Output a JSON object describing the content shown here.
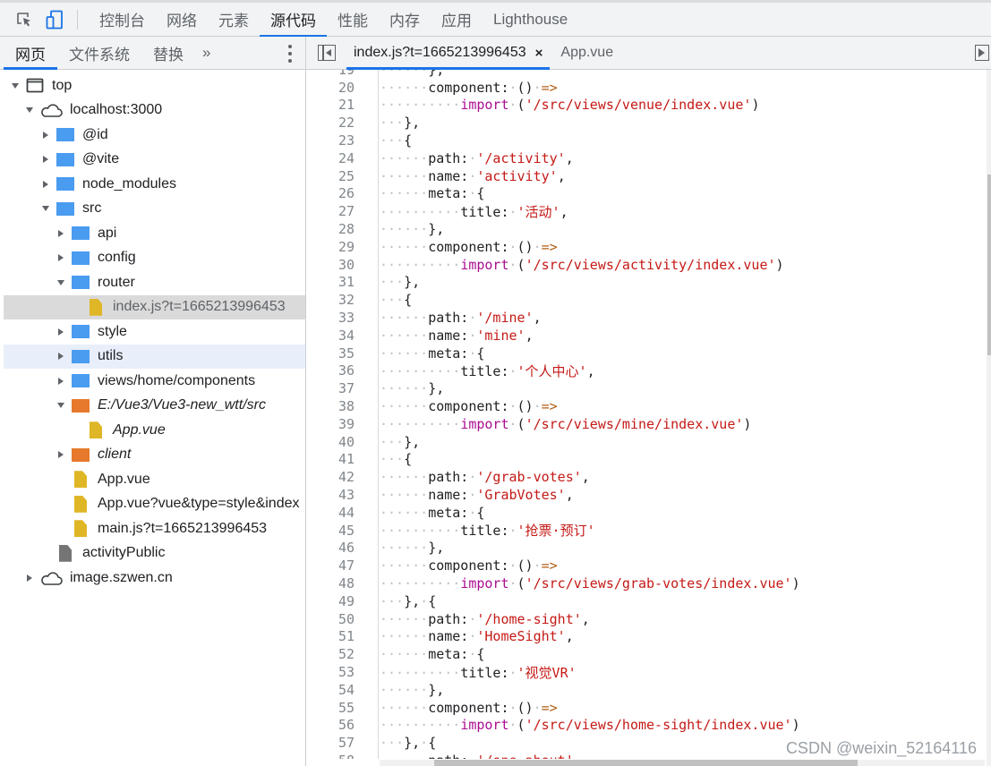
{
  "toolbar": {
    "inspect_icon": "element-picker-icon",
    "device_icon": "device-toolbar-icon",
    "tabs": [
      {
        "label": "控制台",
        "active": false
      },
      {
        "label": "网络",
        "active": false
      },
      {
        "label": "元素",
        "active": false
      },
      {
        "label": "源代码",
        "active": true
      },
      {
        "label": "性能",
        "active": false
      },
      {
        "label": "内存",
        "active": false
      },
      {
        "label": "应用",
        "active": false
      },
      {
        "label": "Lighthouse",
        "active": false
      }
    ]
  },
  "navigator": {
    "tabs": [
      {
        "label": "网页",
        "active": true
      },
      {
        "label": "文件系统",
        "active": false
      },
      {
        "label": "替换",
        "active": false
      }
    ],
    "more_label": "»",
    "tree": [
      {
        "label": "top",
        "depth": 0,
        "arrow": "down",
        "icon": "frame",
        "state": ""
      },
      {
        "label": "localhost:3000",
        "depth": 1,
        "arrow": "down",
        "icon": "cloud",
        "state": ""
      },
      {
        "label": "@id",
        "depth": 2,
        "arrow": "right",
        "icon": "folder-blue",
        "state": ""
      },
      {
        "label": "@vite",
        "depth": 2,
        "arrow": "right",
        "icon": "folder-blue",
        "state": ""
      },
      {
        "label": "node_modules",
        "depth": 2,
        "arrow": "right",
        "icon": "folder-blue",
        "state": ""
      },
      {
        "label": "src",
        "depth": 2,
        "arrow": "down",
        "icon": "folder-blue",
        "state": ""
      },
      {
        "label": "api",
        "depth": 3,
        "arrow": "right",
        "icon": "folder-blue",
        "state": ""
      },
      {
        "label": "config",
        "depth": 3,
        "arrow": "right",
        "icon": "folder-blue",
        "state": ""
      },
      {
        "label": "router",
        "depth": 3,
        "arrow": "down",
        "icon": "folder-blue",
        "state": ""
      },
      {
        "label": "index.js?t=1665213996453",
        "depth": 4,
        "arrow": "none",
        "icon": "file-yellow",
        "state": "selected"
      },
      {
        "label": "style",
        "depth": 3,
        "arrow": "right",
        "icon": "folder-blue",
        "state": ""
      },
      {
        "label": "utils",
        "depth": 3,
        "arrow": "right",
        "icon": "folder-blue",
        "state": "hover"
      },
      {
        "label": "views/home/components",
        "depth": 3,
        "arrow": "right",
        "icon": "folder-blue",
        "state": ""
      },
      {
        "label": "E:/Vue3/Vue3-new_wtt/src",
        "depth": 3,
        "arrow": "down",
        "icon": "folder-orange",
        "state": "italic"
      },
      {
        "label": "App.vue",
        "depth": 4,
        "arrow": "none",
        "icon": "file-yellow",
        "state": "italic"
      },
      {
        "label": "client",
        "depth": 3,
        "arrow": "right",
        "icon": "folder-orange",
        "state": "italic"
      },
      {
        "label": "App.vue",
        "depth": 3,
        "arrow": "none",
        "icon": "file-yellow",
        "state": ""
      },
      {
        "label": "App.vue?vue&type=style&index",
        "depth": 3,
        "arrow": "none",
        "icon": "file-yellow",
        "state": ""
      },
      {
        "label": "main.js?t=1665213996453",
        "depth": 3,
        "arrow": "none",
        "icon": "file-yellow",
        "state": ""
      },
      {
        "label": "activityPublic",
        "depth": 2,
        "arrow": "none",
        "icon": "file-gray",
        "state": ""
      },
      {
        "label": "image.szwen.cn",
        "depth": 1,
        "arrow": "right",
        "icon": "cloud",
        "state": ""
      }
    ]
  },
  "editor": {
    "open_tabs": [
      {
        "label": "index.js?t=1665213996453",
        "active": true,
        "close_label": "×"
      },
      {
        "label": "App.vue",
        "active": false
      }
    ],
    "lines": [
      {
        "n": 19,
        "indent": 6,
        "tokens": [
          [
            "p",
            "},"
          ]
        ]
      },
      {
        "n": 20,
        "indent": 6,
        "tokens": [
          [
            "p",
            "component:"
          ],
          [
            "d",
            "·"
          ],
          [
            "p",
            "()"
          ],
          [
            "d",
            "·"
          ],
          [
            "o",
            "=>"
          ]
        ]
      },
      {
        "n": 21,
        "indent": 10,
        "tokens": [
          [
            "k",
            "import"
          ],
          [
            "d",
            "·"
          ],
          [
            "p",
            "("
          ],
          [
            "s",
            "'/src/views/venue/index.vue'"
          ],
          [
            "p",
            ")"
          ]
        ]
      },
      {
        "n": 22,
        "indent": 3,
        "tokens": [
          [
            "p",
            "},"
          ]
        ]
      },
      {
        "n": 23,
        "indent": 3,
        "tokens": [
          [
            "p",
            "{"
          ]
        ]
      },
      {
        "n": 24,
        "indent": 6,
        "tokens": [
          [
            "p",
            "path:"
          ],
          [
            "d",
            "·"
          ],
          [
            "s",
            "'/activity'"
          ],
          [
            "p",
            ","
          ]
        ]
      },
      {
        "n": 25,
        "indent": 6,
        "tokens": [
          [
            "p",
            "name:"
          ],
          [
            "d",
            "·"
          ],
          [
            "s",
            "'activity'"
          ],
          [
            "p",
            ","
          ]
        ]
      },
      {
        "n": 26,
        "indent": 6,
        "tokens": [
          [
            "p",
            "meta:"
          ],
          [
            "d",
            "·"
          ],
          [
            "p",
            "{"
          ]
        ]
      },
      {
        "n": 27,
        "indent": 10,
        "tokens": [
          [
            "p",
            "title:"
          ],
          [
            "d",
            "·"
          ],
          [
            "s",
            "'活动'"
          ],
          [
            "p",
            ","
          ]
        ]
      },
      {
        "n": 28,
        "indent": 6,
        "tokens": [
          [
            "p",
            "},"
          ]
        ]
      },
      {
        "n": 29,
        "indent": 6,
        "tokens": [
          [
            "p",
            "component:"
          ],
          [
            "d",
            "·"
          ],
          [
            "p",
            "()"
          ],
          [
            "d",
            "·"
          ],
          [
            "o",
            "=>"
          ]
        ]
      },
      {
        "n": 30,
        "indent": 10,
        "tokens": [
          [
            "k",
            "import"
          ],
          [
            "d",
            "·"
          ],
          [
            "p",
            "("
          ],
          [
            "s",
            "'/src/views/activity/index.vue'"
          ],
          [
            "p",
            ")"
          ]
        ]
      },
      {
        "n": 31,
        "indent": 3,
        "tokens": [
          [
            "p",
            "},"
          ]
        ]
      },
      {
        "n": 32,
        "indent": 3,
        "tokens": [
          [
            "p",
            "{"
          ]
        ]
      },
      {
        "n": 33,
        "indent": 6,
        "tokens": [
          [
            "p",
            "path:"
          ],
          [
            "d",
            "·"
          ],
          [
            "s",
            "'/mine'"
          ],
          [
            "p",
            ","
          ]
        ]
      },
      {
        "n": 34,
        "indent": 6,
        "tokens": [
          [
            "p",
            "name:"
          ],
          [
            "d",
            "·"
          ],
          [
            "s",
            "'mine'"
          ],
          [
            "p",
            ","
          ]
        ]
      },
      {
        "n": 35,
        "indent": 6,
        "tokens": [
          [
            "p",
            "meta:"
          ],
          [
            "d",
            "·"
          ],
          [
            "p",
            "{"
          ]
        ]
      },
      {
        "n": 36,
        "indent": 10,
        "tokens": [
          [
            "p",
            "title:"
          ],
          [
            "d",
            "·"
          ],
          [
            "s",
            "'个人中心'"
          ],
          [
            "p",
            ","
          ]
        ]
      },
      {
        "n": 37,
        "indent": 6,
        "tokens": [
          [
            "p",
            "},"
          ]
        ]
      },
      {
        "n": 38,
        "indent": 6,
        "tokens": [
          [
            "p",
            "component:"
          ],
          [
            "d",
            "·"
          ],
          [
            "p",
            "()"
          ],
          [
            "d",
            "·"
          ],
          [
            "o",
            "=>"
          ]
        ]
      },
      {
        "n": 39,
        "indent": 10,
        "tokens": [
          [
            "k",
            "import"
          ],
          [
            "d",
            "·"
          ],
          [
            "p",
            "("
          ],
          [
            "s",
            "'/src/views/mine/index.vue'"
          ],
          [
            "p",
            ")"
          ]
        ]
      },
      {
        "n": 40,
        "indent": 3,
        "tokens": [
          [
            "p",
            "},"
          ]
        ]
      },
      {
        "n": 41,
        "indent": 3,
        "tokens": [
          [
            "p",
            "{"
          ]
        ]
      },
      {
        "n": 42,
        "indent": 6,
        "tokens": [
          [
            "p",
            "path:"
          ],
          [
            "d",
            "·"
          ],
          [
            "s",
            "'/grab-votes'"
          ],
          [
            "p",
            ","
          ]
        ]
      },
      {
        "n": 43,
        "indent": 6,
        "tokens": [
          [
            "p",
            "name:"
          ],
          [
            "d",
            "·"
          ],
          [
            "s",
            "'GrabVotes'"
          ],
          [
            "p",
            ","
          ]
        ]
      },
      {
        "n": 44,
        "indent": 6,
        "tokens": [
          [
            "p",
            "meta:"
          ],
          [
            "d",
            "·"
          ],
          [
            "p",
            "{"
          ]
        ]
      },
      {
        "n": 45,
        "indent": 10,
        "tokens": [
          [
            "p",
            "title:"
          ],
          [
            "d",
            "·"
          ],
          [
            "s",
            "'抢票·预订'"
          ]
        ]
      },
      {
        "n": 46,
        "indent": 6,
        "tokens": [
          [
            "p",
            "},"
          ]
        ]
      },
      {
        "n": 47,
        "indent": 6,
        "tokens": [
          [
            "p",
            "component:"
          ],
          [
            "d",
            "·"
          ],
          [
            "p",
            "()"
          ],
          [
            "d",
            "·"
          ],
          [
            "o",
            "=>"
          ]
        ]
      },
      {
        "n": 48,
        "indent": 10,
        "tokens": [
          [
            "k",
            "import"
          ],
          [
            "d",
            "·"
          ],
          [
            "p",
            "("
          ],
          [
            "s",
            "'/src/views/grab-votes/index.vue'"
          ],
          [
            "p",
            ")"
          ]
        ]
      },
      {
        "n": 49,
        "indent": 3,
        "tokens": [
          [
            "p",
            "},"
          ],
          [
            "d",
            "·"
          ],
          [
            "p",
            "{"
          ]
        ]
      },
      {
        "n": 50,
        "indent": 6,
        "tokens": [
          [
            "p",
            "path:"
          ],
          [
            "d",
            "·"
          ],
          [
            "s",
            "'/home-sight'"
          ],
          [
            "p",
            ","
          ]
        ]
      },
      {
        "n": 51,
        "indent": 6,
        "tokens": [
          [
            "p",
            "name:"
          ],
          [
            "d",
            "·"
          ],
          [
            "s",
            "'HomeSight'"
          ],
          [
            "p",
            ","
          ]
        ]
      },
      {
        "n": 52,
        "indent": 6,
        "tokens": [
          [
            "p",
            "meta:"
          ],
          [
            "d",
            "·"
          ],
          [
            "p",
            "{"
          ]
        ]
      },
      {
        "n": 53,
        "indent": 10,
        "tokens": [
          [
            "p",
            "title:"
          ],
          [
            "d",
            "·"
          ],
          [
            "s",
            "'视觉VR'"
          ]
        ]
      },
      {
        "n": 54,
        "indent": 6,
        "tokens": [
          [
            "p",
            "},"
          ]
        ]
      },
      {
        "n": 55,
        "indent": 6,
        "tokens": [
          [
            "p",
            "component:"
          ],
          [
            "d",
            "·"
          ],
          [
            "p",
            "()"
          ],
          [
            "d",
            "·"
          ],
          [
            "o",
            "=>"
          ]
        ]
      },
      {
        "n": 56,
        "indent": 10,
        "tokens": [
          [
            "k",
            "import"
          ],
          [
            "d",
            "·"
          ],
          [
            "p",
            "("
          ],
          [
            "s",
            "'/src/views/home-sight/index.vue'"
          ],
          [
            "p",
            ")"
          ]
        ]
      },
      {
        "n": 57,
        "indent": 3,
        "tokens": [
          [
            "p",
            "},"
          ],
          [
            "d",
            "·"
          ],
          [
            "p",
            "{"
          ]
        ]
      },
      {
        "n": 58,
        "indent": 6,
        "tokens": [
          [
            "p",
            "path:"
          ],
          [
            "d",
            "·"
          ],
          [
            "s",
            "'/one-about'"
          ]
        ]
      }
    ],
    "vertical_scroll_fraction": {
      "start": 0.15,
      "end": 0.41
    },
    "horizontal_scroll_fraction": {
      "start": 0.09,
      "end": 0.79
    }
  },
  "colors": {
    "accent": "#1a73e8",
    "keyword": "#aa0d91",
    "string": "#c41a16",
    "operator": "#b35d13"
  },
  "watermark": "CSDN @weixin_52164116"
}
